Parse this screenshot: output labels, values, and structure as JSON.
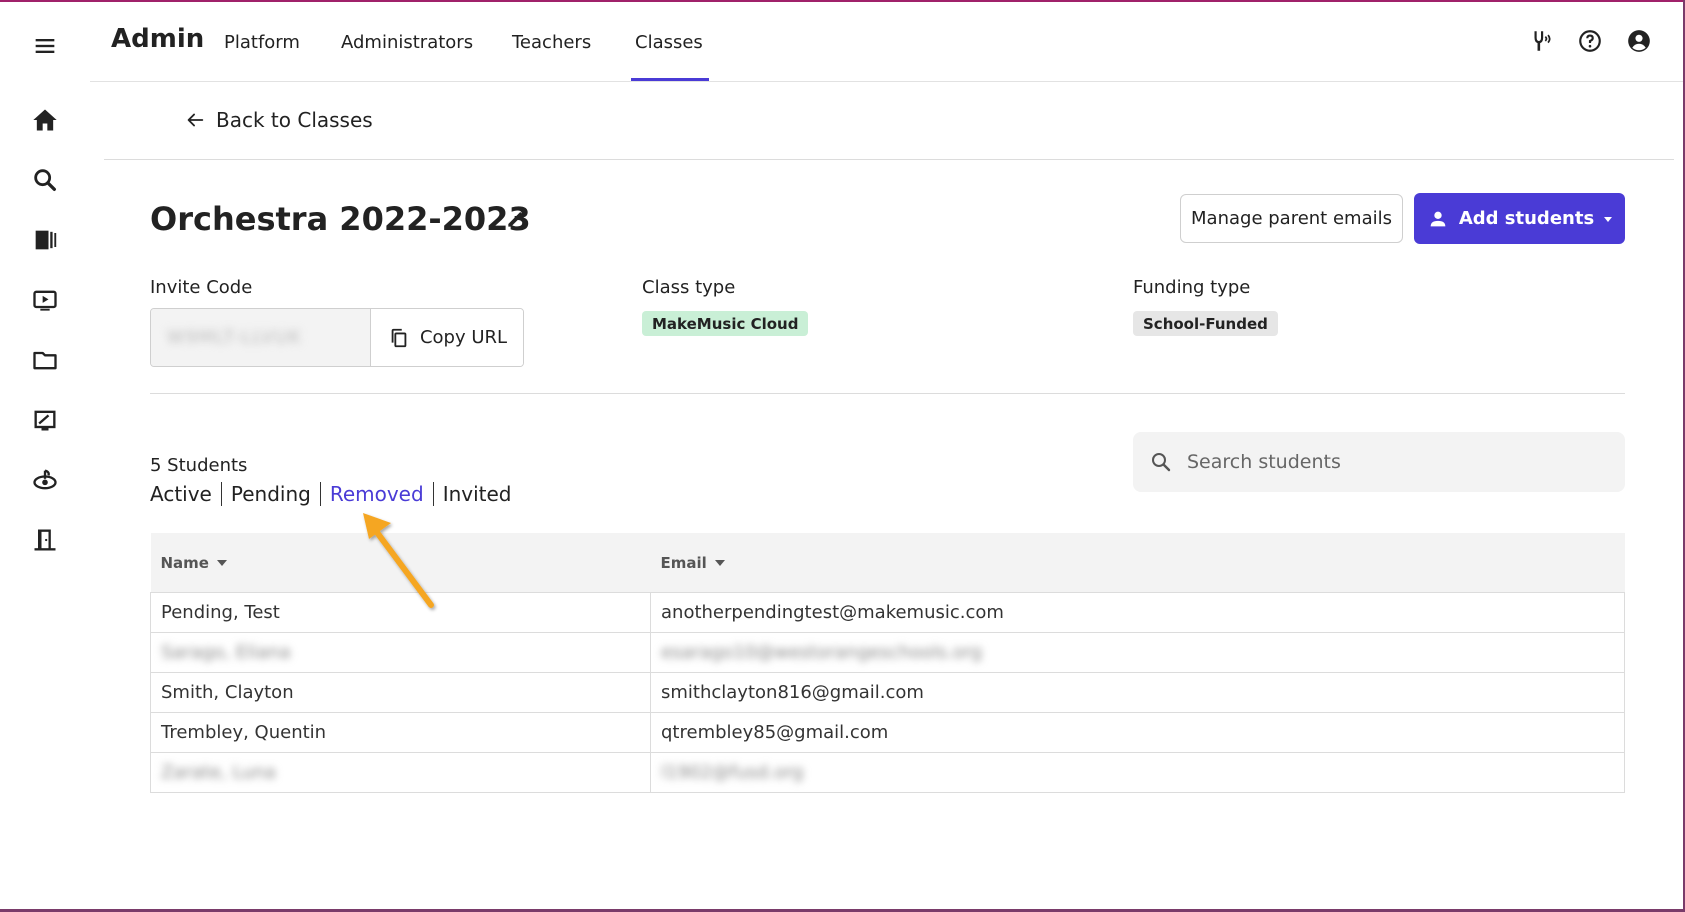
{
  "app": {
    "brand": "Admin"
  },
  "nav": {
    "links": [
      "Platform",
      "Administrators",
      "Teachers",
      "Classes"
    ],
    "active": "Classes"
  },
  "rail": {
    "icons": [
      "menu-icon",
      "home-icon",
      "search-icon",
      "library-icon",
      "video-icon",
      "folder-icon",
      "assignment-icon",
      "practice-icon",
      "exit-icon"
    ]
  },
  "back": {
    "label": "Back to Classes"
  },
  "class": {
    "title": "Orchestra 2022-2023",
    "manage_parent_emails": "Manage parent emails",
    "add_students": "Add students"
  },
  "meta": {
    "invite_label": "Invite Code",
    "invite_code": "W9MLT-LLVUK",
    "copy_url": "Copy URL",
    "class_type_label": "Class type",
    "class_type": "MakeMusic Cloud",
    "funding_type_label": "Funding type",
    "funding_type": "School-Funded"
  },
  "students": {
    "count_label": "5 Students",
    "filters": [
      "Active",
      "Pending",
      "Removed",
      "Invited"
    ],
    "active_filter": "Removed",
    "search_placeholder": "Search students"
  },
  "table": {
    "columns": [
      "Name",
      "Email"
    ],
    "rows": [
      {
        "name": "Pending, Test",
        "email": "anotherpendingtest@makemusic.com",
        "blurred": false
      },
      {
        "name": "Sarago, Eliana",
        "email": "esarago10@westorangeschools.org",
        "blurred": true
      },
      {
        "name": "Smith, Clayton",
        "email": "smithclayton816@gmail.com",
        "blurred": false
      },
      {
        "name": "Trembley, Quentin",
        "email": "qtrembley85@gmail.com",
        "blurred": false
      },
      {
        "name": "Zarate, Luna",
        "email": "l1902@fusd.org",
        "blurred": true
      }
    ]
  },
  "colors": {
    "accent": "#4a3bd6",
    "class_type_badge": "#c9efd6",
    "funding_badge": "#e6e6e6",
    "annotation_arrow": "#f5a623"
  }
}
